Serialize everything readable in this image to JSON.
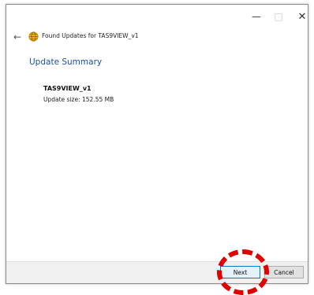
{
  "window": {
    "title": "Found Updates for TAS9VIEW_v1",
    "controls": {
      "minimize_icon": "minimize-icon",
      "maximize_icon": "maximize-icon",
      "close_icon": "close-icon"
    }
  },
  "content": {
    "heading": "Update Summary",
    "product_name": "TAS9VIEW_v1",
    "update_size": "Update size: 152.55 MB"
  },
  "footer": {
    "next_label": "Next",
    "cancel_label": "Cancel"
  },
  "colors": {
    "heading": "#1f4fa8",
    "highlight": "#e00000",
    "footer_bg": "#f0f0f0",
    "default_button_border": "#0078d7"
  }
}
